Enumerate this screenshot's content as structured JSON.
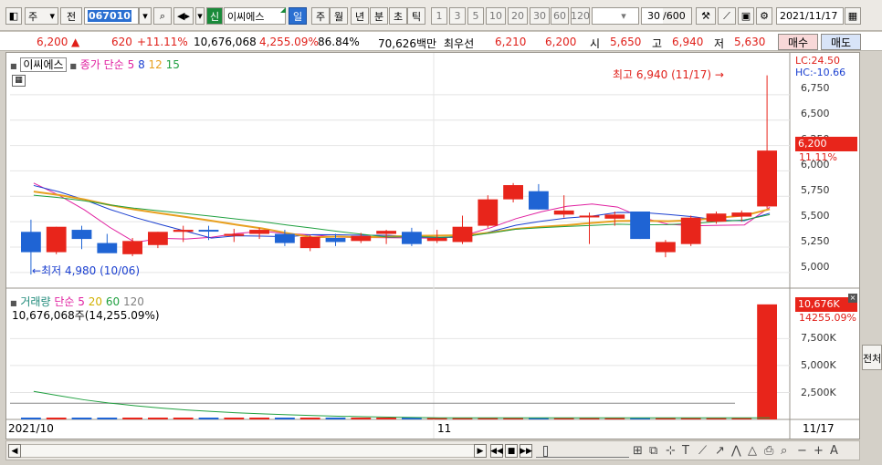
{
  "toolbar": {
    "market_type": "주",
    "prev_label": "전",
    "stock_code": "067010",
    "listing_badge": "신",
    "stock_name": "이씨에스",
    "period_tabs": [
      "일",
      "주",
      "월",
      "년",
      "분",
      "초",
      "틱"
    ],
    "period_selected": "일",
    "interval_buttons": [
      "1",
      "3",
      "5",
      "10",
      "20",
      "30",
      "60",
      "120"
    ],
    "count": "30",
    "count_total": "/600",
    "date": "2021/11/17"
  },
  "quote": {
    "price": "6,200",
    "change_arrow": "▲",
    "change": "620",
    "change_pct": "+11.11%",
    "volume": "10,676,068",
    "volume_ratio": "4,255.09%",
    "turnover_pct": "86.84%",
    "trade_amount": "70,626백만",
    "best_ask_label": "최우선",
    "best_ask": "6,210",
    "best_bid": "6,200",
    "open_label": "시",
    "open": "5,650",
    "high_label": "고",
    "high": "6,940",
    "low_label": "저",
    "low": "5,630",
    "buy_label": "매수",
    "sell_label": "매도"
  },
  "price_legend": {
    "stock": "이씨에스",
    "ma_label": "종가 단순",
    "ma_periods": [
      "5",
      "8",
      "12",
      "15"
    ],
    "ma_colors": [
      "#e020a0",
      "#1a3fd0",
      "#e8a020",
      "#20a040"
    ]
  },
  "volume_legend": {
    "label": "거래량",
    "ma_label": "단순",
    "ma_periods": [
      "5",
      "20",
      "60",
      "120"
    ],
    "ma_colors": [
      "#e020a0",
      "#d0b000",
      "#20a040",
      "#808080"
    ],
    "current_volume_text": "10,676,068주(14,255.09%)"
  },
  "price_axis": {
    "lc": "LC:24.50",
    "hc": "HC:-10.66",
    "current_tag": "6,200",
    "current_change": "11.11%",
    "ticks": [
      "6,750",
      "6,500",
      "6,250",
      "6,000",
      "5,750",
      "5,500",
      "5,250",
      "5,000"
    ]
  },
  "volume_axis": {
    "current_tag": "10,676K",
    "current_ratio": "14255.09%",
    "ticks": [
      "7,500K",
      "5,000K",
      "2,500K"
    ]
  },
  "annotations": {
    "high_text": "최고 6,940 (11/17)",
    "high_arrow": "→",
    "low_text": "최저 4,980 (10/06)",
    "low_arrow": "←"
  },
  "x_axis": {
    "labels": [
      "2021/10",
      "11"
    ],
    "right_label": "11/17"
  },
  "side_label": "전처",
  "colors": {
    "up": "#e8251b",
    "down": "#1f64d4",
    "grid": "#e4e4e4"
  },
  "chart_data": {
    "type": "candlestick",
    "ylim": [
      4900,
      7000
    ],
    "candles": [
      {
        "o": 5400,
        "h": 5520,
        "l": 4980,
        "c": 5200
      },
      {
        "o": 5200,
        "h": 5450,
        "l": 5180,
        "c": 5450
      },
      {
        "o": 5420,
        "h": 5460,
        "l": 5230,
        "c": 5330
      },
      {
        "o": 5290,
        "h": 5380,
        "l": 5200,
        "c": 5190
      },
      {
        "o": 5180,
        "h": 5340,
        "l": 5160,
        "c": 5310
      },
      {
        "o": 5270,
        "h": 5400,
        "l": 5240,
        "c": 5400
      },
      {
        "o": 5400,
        "h": 5460,
        "l": 5300,
        "c": 5420
      },
      {
        "o": 5420,
        "h": 5460,
        "l": 5320,
        "c": 5410
      },
      {
        "o": 5360,
        "h": 5430,
        "l": 5300,
        "c": 5380
      },
      {
        "o": 5380,
        "h": 5440,
        "l": 5330,
        "c": 5420
      },
      {
        "o": 5380,
        "h": 5420,
        "l": 5260,
        "c": 5290
      },
      {
        "o": 5240,
        "h": 5370,
        "l": 5210,
        "c": 5350
      },
      {
        "o": 5340,
        "h": 5380,
        "l": 5260,
        "c": 5300
      },
      {
        "o": 5310,
        "h": 5390,
        "l": 5290,
        "c": 5360
      },
      {
        "o": 5380,
        "h": 5420,
        "l": 5280,
        "c": 5410
      },
      {
        "o": 5400,
        "h": 5440,
        "l": 5260,
        "c": 5280
      },
      {
        "o": 5310,
        "h": 5420,
        "l": 5290,
        "c": 5340
      },
      {
        "o": 5300,
        "h": 5560,
        "l": 5280,
        "c": 5450
      },
      {
        "o": 5460,
        "h": 5760,
        "l": 5440,
        "c": 5720
      },
      {
        "o": 5720,
        "h": 5880,
        "l": 5690,
        "c": 5860
      },
      {
        "o": 5800,
        "h": 5870,
        "l": 5620,
        "c": 5620
      },
      {
        "o": 5570,
        "h": 5760,
        "l": 5540,
        "c": 5610
      },
      {
        "o": 5560,
        "h": 5590,
        "l": 5280,
        "c": 5560
      },
      {
        "o": 5530,
        "h": 5600,
        "l": 5460,
        "c": 5570
      },
      {
        "o": 5600,
        "h": 5600,
        "l": 5330,
        "c": 5330
      },
      {
        "o": 5200,
        "h": 5320,
        "l": 5150,
        "c": 5300
      },
      {
        "o": 5280,
        "h": 5560,
        "l": 5260,
        "c": 5540
      },
      {
        "o": 5500,
        "h": 5600,
        "l": 5480,
        "c": 5580
      },
      {
        "o": 5550,
        "h": 5610,
        "l": 5500,
        "c": 5590
      },
      {
        "o": 5650,
        "h": 6940,
        "l": 5630,
        "c": 6200
      }
    ],
    "volume_ylim": [
      0,
      11000000
    ],
    "volume": [
      75000,
      70000,
      80000,
      65000,
      70000,
      90000,
      70000,
      65000,
      60000,
      55000,
      60000,
      62000,
      60000,
      58000,
      70000,
      60000,
      58000,
      75000,
      160000,
      120000,
      85000,
      70000,
      80000,
      60000,
      80000,
      65000,
      90000,
      70000,
      75000,
      10676068
    ]
  }
}
